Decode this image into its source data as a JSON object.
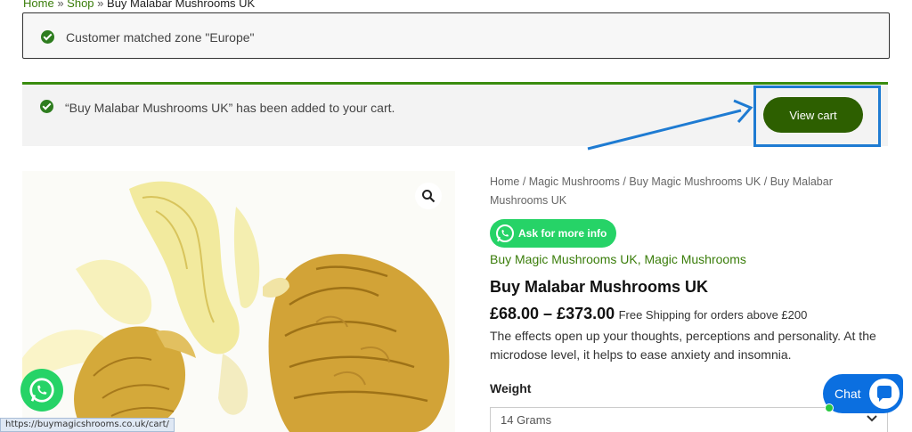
{
  "top_breadcrumb": {
    "home": "Home",
    "sep": "»",
    "shop": "Shop",
    "current": "Buy Malabar Mushrooms UK"
  },
  "notices": {
    "zone": "Customer matched zone \"Europe\"",
    "added": "“Buy Malabar Mushrooms UK” has been added to your cart.",
    "view_cart": "View cart"
  },
  "breadcrumb": {
    "home": "Home",
    "cat1": "Magic Mushrooms",
    "cat2": "Buy Magic Mushrooms UK",
    "current": "Buy Malabar Mushrooms UK",
    "sep": " / "
  },
  "whatsapp_button": "Ask for more info",
  "categories": {
    "a": "Buy Magic Mushrooms UK",
    "b": "Magic Mushrooms",
    "comma": ", "
  },
  "product": {
    "title": "Buy Malabar Mushrooms UK",
    "price": "£68.00 – £373.00",
    "shipping": "Free Shipping for orders above £200",
    "description": "The effects open up your thoughts, perceptions and personality. At the microdose level, it helps to ease anxiety and insomnia."
  },
  "weight": {
    "label": "Weight",
    "selected": "14 Grams"
  },
  "chat_label": "Chat",
  "status_url": "https://buymagicshrooms.co.uk/cart/",
  "colors": {
    "brand_green": "#2d5f00",
    "link_green": "#3a7d0a",
    "whatsapp": "#26d367",
    "chat_blue": "#0b6fe0",
    "annotation_blue": "#1e7bd2"
  }
}
